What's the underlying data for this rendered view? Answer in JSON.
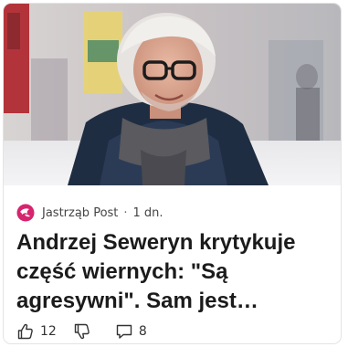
{
  "article": {
    "source": "Jastrząb Post",
    "separator": "·",
    "age": "1 dn.",
    "title_line1": "Andrzej Seweryn krytykuje",
    "title_line2": "część wiernych: \"Są",
    "title_line3": "agresywni\". Sam jest…"
  },
  "reactions": {
    "likes": "12",
    "comments": "8"
  },
  "icons": {
    "source_logo": "jastrzab-post-logo",
    "like": "thumbs-up-icon",
    "dislike": "thumbs-down-icon",
    "comment": "comment-icon"
  },
  "colors": {
    "logo_pink": "#d6246e",
    "title_text": "#1b1b1b",
    "meta_text": "#444444"
  }
}
